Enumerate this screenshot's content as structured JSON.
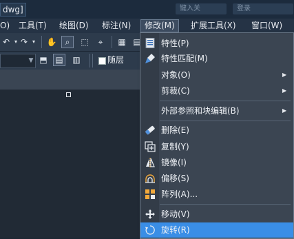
{
  "title_bar": {
    "title": "dwg]",
    "search_placeholder": "键入关",
    "login_text": "登录"
  },
  "menubar": {
    "items": [
      {
        "label": "O)"
      },
      {
        "label": "工具(T)"
      },
      {
        "label": "绘图(D)"
      },
      {
        "label": "标注(N)"
      },
      {
        "label": "修改(M)"
      },
      {
        "label": "扩展工具(X)"
      },
      {
        "label": "窗口(W)"
      }
    ]
  },
  "toolbar": {
    "color_label": "随层"
  },
  "modify_menu": {
    "items": [
      {
        "label": "特性(P)",
        "icon": "properties-icon",
        "submenu": false
      },
      {
        "label": "特性匹配(M)",
        "icon": "match-properties-icon",
        "submenu": false
      },
      {
        "label": "对象(O)",
        "icon": "",
        "submenu": true
      },
      {
        "label": "剪裁(C)",
        "icon": "",
        "submenu": true
      },
      {
        "label": "外部参照和块编辑(B)",
        "icon": "",
        "submenu": true
      },
      {
        "label": "删除(E)",
        "icon": "erase-icon",
        "submenu": false
      },
      {
        "label": "复制(Y)",
        "icon": "copy-icon",
        "submenu": false
      },
      {
        "label": "镜像(I)",
        "icon": "mirror-icon",
        "submenu": false
      },
      {
        "label": "偏移(S)",
        "icon": "offset-icon",
        "submenu": false
      },
      {
        "label": "阵列(A)...",
        "icon": "array-icon",
        "submenu": false
      },
      {
        "label": "移动(V)",
        "icon": "move-icon",
        "submenu": false
      },
      {
        "label": "旋转(R)",
        "icon": "rotate-icon",
        "submenu": false,
        "highlighted": true
      }
    ],
    "arrow_glyph": "▶"
  },
  "colors": {
    "highlight": "#3a8ee6",
    "menu_bg": "#3b4552",
    "canvas_bg": "#212a35"
  }
}
